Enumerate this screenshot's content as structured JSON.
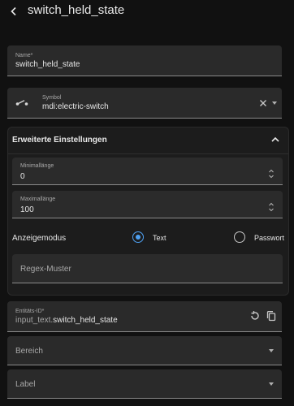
{
  "header": {
    "title": "switch_held_state",
    "back_icon": "chevron-left-icon"
  },
  "name_field": {
    "label": "Name*",
    "value": "switch_held_state"
  },
  "symbol_field": {
    "label": "Symbol",
    "value": "mdi:electric-switch",
    "icon": "electric-switch-icon"
  },
  "advanced": {
    "title": "Erweiterte Einstellungen",
    "expanded": true,
    "min_length": {
      "label": "Minimallänge",
      "value": "0"
    },
    "max_length": {
      "label": "Maximallänge",
      "value": "100"
    },
    "display_mode": {
      "label": "Anzeigemodus",
      "options": [
        {
          "label": "Text",
          "selected": true
        },
        {
          "label": "Passwort",
          "selected": false
        }
      ]
    },
    "regex": {
      "placeholder": "Regex-Muster"
    }
  },
  "entity_id_field": {
    "label": "Entitäts-ID*",
    "prefix": "input_text.",
    "value": "switch_held_state"
  },
  "area_field": {
    "placeholder": "Bereich"
  },
  "label_field": {
    "placeholder": "Label"
  },
  "colors": {
    "background": "#111111",
    "field": "#2a2a2a",
    "accent": "#4ea1f3"
  }
}
